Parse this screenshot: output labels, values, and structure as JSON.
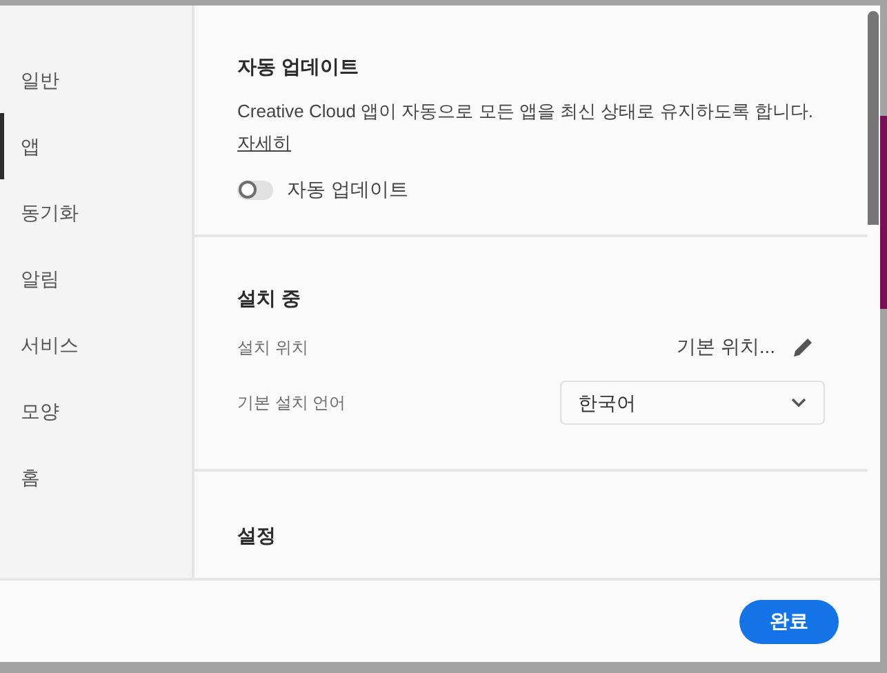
{
  "sidebar": {
    "items": [
      {
        "label": "일반",
        "selected": false
      },
      {
        "label": "앱",
        "selected": true
      },
      {
        "label": "동기화",
        "selected": false
      },
      {
        "label": "알림",
        "selected": false
      },
      {
        "label": "서비스",
        "selected": false
      },
      {
        "label": "모양",
        "selected": false
      },
      {
        "label": "홈",
        "selected": false
      }
    ]
  },
  "auto_update": {
    "title": "자동 업데이트",
    "description": "Creative Cloud 앱이 자동으로 모든 앱을 최신 상태로 유지하도록 합니다.",
    "link": "자세히",
    "toggle": {
      "label": "자동 업데이트",
      "on": false
    }
  },
  "installation": {
    "title": "설치 중",
    "location": {
      "label": "설치 위치",
      "value": "기본 위치..."
    },
    "language": {
      "label": "기본 설치 언어",
      "value": "한국어"
    }
  },
  "settings_section": {
    "title": "설정"
  },
  "footer": {
    "done_button": "완료"
  }
}
